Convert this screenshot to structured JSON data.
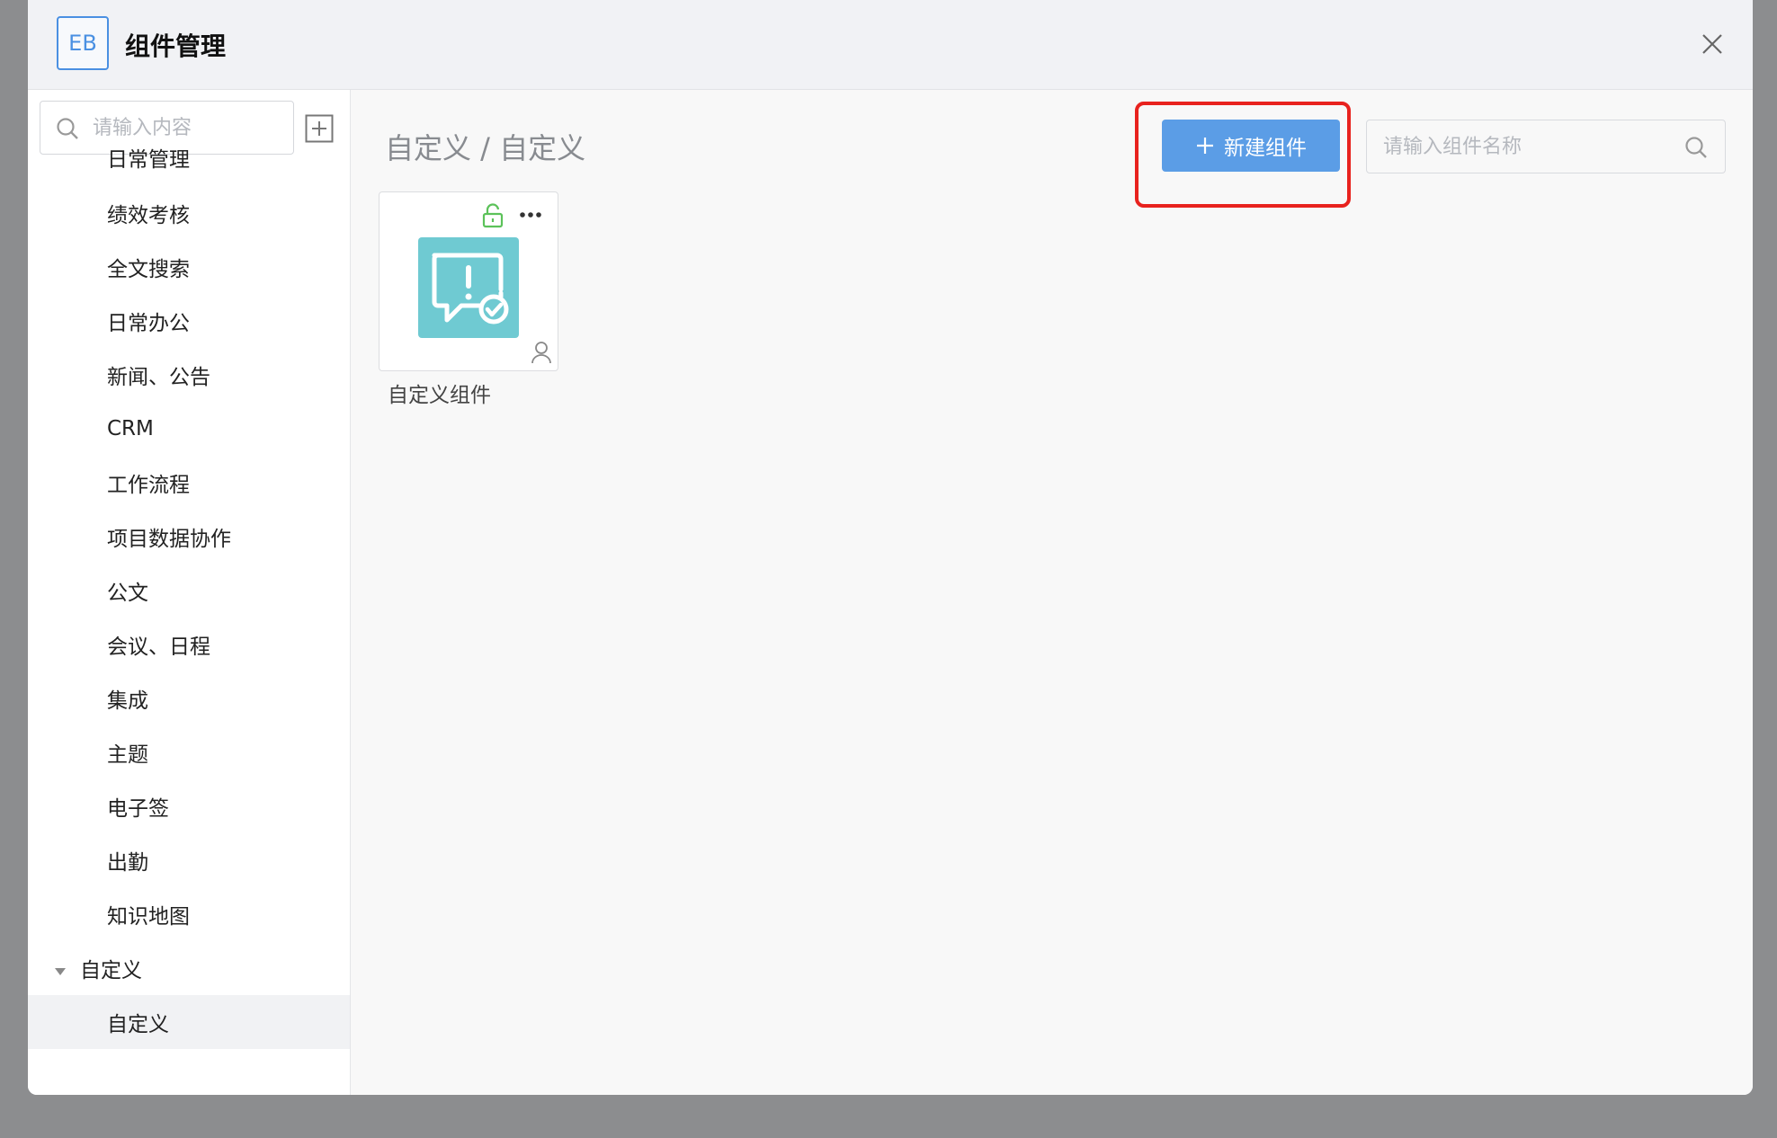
{
  "header": {
    "logo_text": "EB",
    "title": "组件管理"
  },
  "sidebar": {
    "search_placeholder": "请输入内容",
    "items": [
      {
        "label": "日常管理",
        "level": "child"
      },
      {
        "label": "绩效考核",
        "level": "child"
      },
      {
        "label": "全文搜索",
        "level": "child"
      },
      {
        "label": "日常办公",
        "level": "child"
      },
      {
        "label": "新闻、公告",
        "level": "child"
      },
      {
        "label": "CRM",
        "level": "child"
      },
      {
        "label": "工作流程",
        "level": "child"
      },
      {
        "label": "项目数据协作",
        "level": "child"
      },
      {
        "label": "公文",
        "level": "child"
      },
      {
        "label": "会议、日程",
        "level": "child"
      },
      {
        "label": "集成",
        "level": "child"
      },
      {
        "label": "主题",
        "level": "child"
      },
      {
        "label": "电子签",
        "level": "child"
      },
      {
        "label": "出勤",
        "level": "child"
      },
      {
        "label": "知识地图",
        "level": "child"
      },
      {
        "label": "自定义",
        "level": "parent",
        "expanded": true
      },
      {
        "label": "自定义",
        "level": "child",
        "selected": true
      }
    ]
  },
  "main": {
    "breadcrumb": "自定义 / 自定义",
    "new_button_label": "新建组件",
    "search_placeholder": "请输入组件名称",
    "cards": [
      {
        "label": "自定义组件",
        "icon": "message-check-icon",
        "locked": false
      }
    ]
  },
  "colors": {
    "primary": "#5b9de6",
    "highlight": "#e8221e",
    "tile": "#6fcad2",
    "unlock": "#5cc25a"
  }
}
